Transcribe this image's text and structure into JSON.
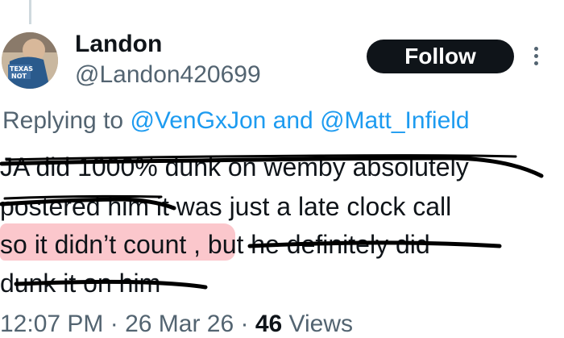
{
  "author": {
    "name": "Landon",
    "handle": "@Landon420699",
    "avatar_icon": "profile-photo"
  },
  "actions": {
    "follow_label": "Follow",
    "more_icon": "more-vertical-icon"
  },
  "reply": {
    "prefix": "Replying to ",
    "mention1": "@VenGxJon",
    "joiner": " and ",
    "mention2": "@Matt_Infield"
  },
  "tweet": {
    "line1": "JA did 1000% dunk on wemby absolutely",
    "line2": "postered him it was just a late clock call",
    "line3": "so it didn’t count , but he definitely did",
    "line4": "dunk it on him"
  },
  "meta": {
    "time": "12:07 PM · 26 Mar 26 · ",
    "views_count": "46",
    "views_label": " Views"
  },
  "colors": {
    "link": "#1d9bf0",
    "secondary_text": "#536471",
    "follow_bg": "#0f1419",
    "highlight": "#f7828e"
  }
}
